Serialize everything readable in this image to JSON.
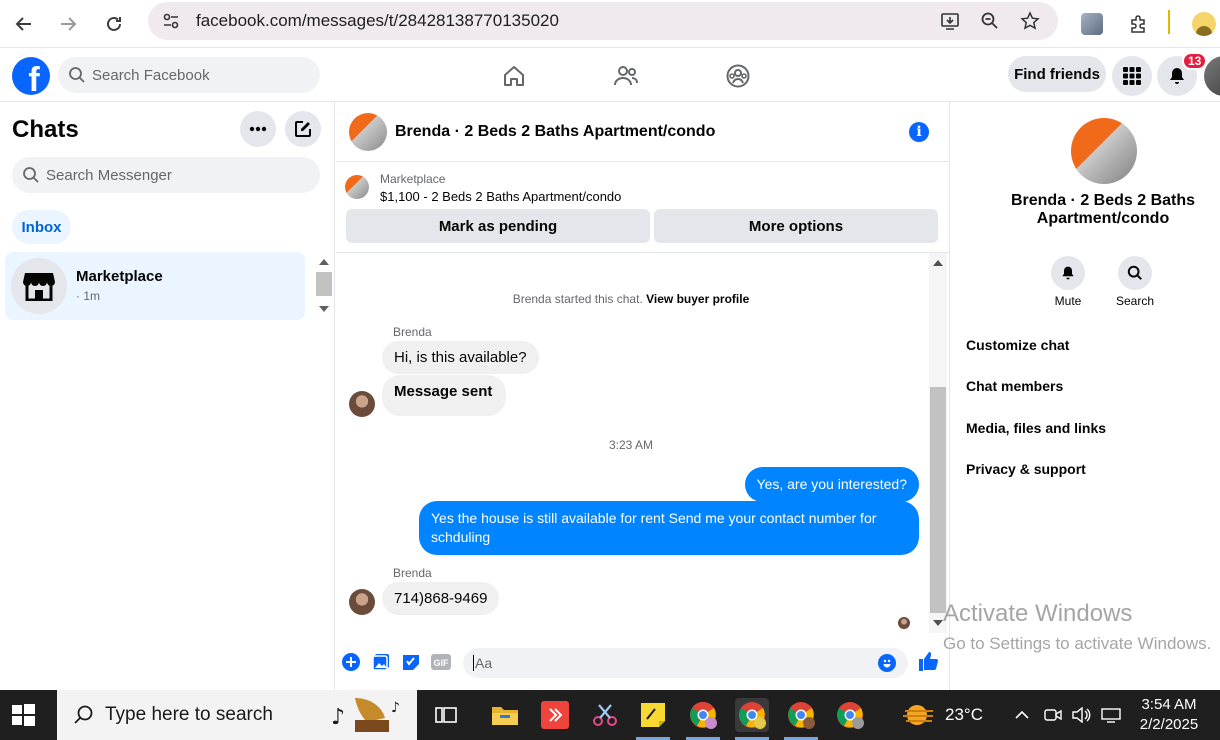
{
  "browser": {
    "url": "facebook.com/messages/t/28428138770135020"
  },
  "fb_header": {
    "logo_letter": "f",
    "search_placeholder": "Search Facebook",
    "find_friends": "Find friends",
    "notification_count": "13"
  },
  "left_panel": {
    "title": "Chats",
    "search_placeholder": "Search Messenger",
    "inbox_label": "Inbox",
    "chats": [
      {
        "name": "Marketplace",
        "meta": "· 1m"
      }
    ]
  },
  "conversation": {
    "title": "Brenda · 2 Beds 2 Baths Apartment/condo",
    "info_glyph": "i",
    "marketplace_label": "Marketplace",
    "listing": "$1,100 - 2 Beds 2 Baths Apartment/condo",
    "mark_pending": "Mark as pending",
    "more_options": "More options",
    "system_text": "Brenda started this chat.",
    "system_link": "View buyer profile",
    "messages": [
      {
        "sender": "Brenda",
        "text": "Hi, is this available?"
      },
      {
        "text": "Message sent"
      },
      {
        "timestamp": "3:23 AM"
      },
      {
        "text": "Yes, are you interested?"
      },
      {
        "text": "Yes the house is still available for rent Send me your contact number for schduling"
      },
      {
        "sender": "Brenda",
        "text": "714)868-9469"
      }
    ],
    "composer_placeholder": "Aa"
  },
  "right_panel": {
    "name": "Brenda · 2 Beds 2 Baths Apartment/condo",
    "actions": [
      {
        "label": "Mute"
      },
      {
        "label": "Search"
      }
    ],
    "menu": [
      "Customize chat",
      "Chat members",
      "Media, files and links",
      "Privacy & support"
    ]
  },
  "watermark": {
    "line1": "Activate Windows",
    "line2": "Go to Settings to activate Windows."
  },
  "taskbar": {
    "search_placeholder": "Type here to search",
    "temperature": "23°C",
    "time": "3:54 AM",
    "date": "2/2/2025"
  },
  "colors": {
    "fb_blue": "#0866ff",
    "bubble_out": "#0084ff",
    "bubble_in": "#f0f0f0",
    "inbox_bg": "#ebf5ff",
    "badge_red": "#e41e3f"
  }
}
